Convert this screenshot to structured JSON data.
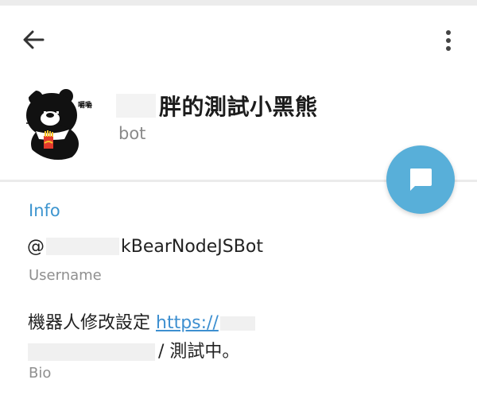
{
  "header": {
    "back_icon": "arrow-left-icon",
    "more_icon": "more-vertical-icon"
  },
  "profile": {
    "avatar_icon": "bear-avatar-icon",
    "avatar_caption": "嚼嚼",
    "name_visible": "胖的測試小黑熊",
    "subtitle": "bot"
  },
  "fab": {
    "icon": "message-icon",
    "color": "#58afd9"
  },
  "info": {
    "section_title": "Info",
    "username_prefix": "@",
    "username_visible": "kBearNodeJSBot",
    "username_label": "Username",
    "bio_text_start": "機器人修改設定 ",
    "bio_link_visible": "https://",
    "bio_text_end": "/ 測試中。",
    "bio_label": "Bio"
  },
  "colors": {
    "accent": "#3d95cf",
    "fab": "#58afd9",
    "link": "#3d8fd0"
  }
}
